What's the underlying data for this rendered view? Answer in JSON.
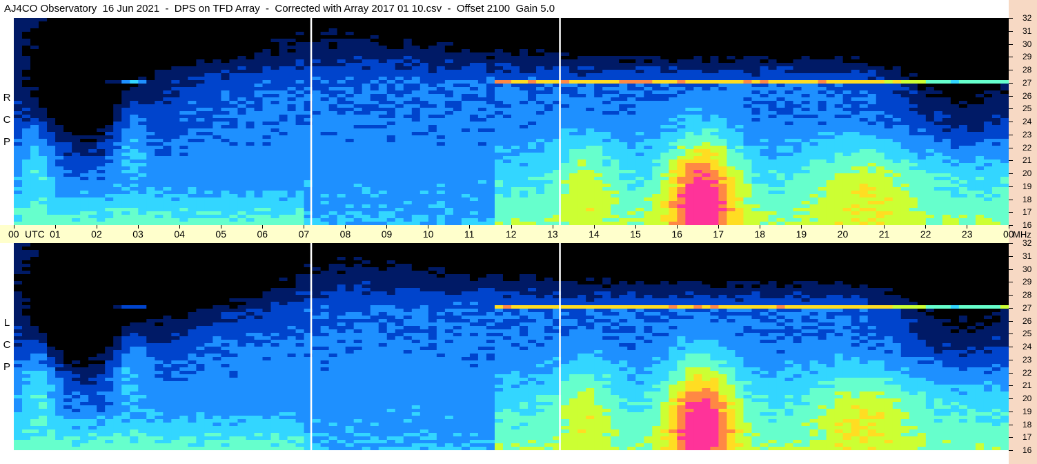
{
  "title": "AJ4CO Observatory  16 Jun 2021  -  DPS on TFD Array  -  Corrected with Array 2017 01 10.csv  -  Offset 2100  Gain 5.0",
  "chart_data": [
    {
      "type": "heatmap",
      "polarization_label": [
        "R",
        "C",
        "P"
      ],
      "x_label": "UTC",
      "y_unit": "MHz",
      "xlim": [
        0,
        24
      ],
      "ylim": [
        16,
        32
      ],
      "x_ticks": [
        "00",
        "01",
        "02",
        "03",
        "04",
        "05",
        "06",
        "07",
        "08",
        "09",
        "10",
        "11",
        "12",
        "13",
        "14",
        "15",
        "16",
        "17",
        "18",
        "19",
        "20",
        "21",
        "22",
        "23",
        "00"
      ],
      "y_ticks": [
        "16",
        "17",
        "18",
        "19",
        "20",
        "21",
        "22",
        "23",
        "24",
        "25",
        "26",
        "27",
        "28",
        "29",
        "30",
        "31",
        "32"
      ],
      "colormap": [
        "#000000",
        "#001a66",
        "#0044cc",
        "#1e90ff",
        "#33d6ff",
        "#66ffcc",
        "#ccff33",
        "#ffdd22",
        "#ff8844",
        "#ff3399"
      ],
      "events": [
        {
          "type": "calibration_line",
          "time": 7.17
        },
        {
          "type": "calibration_line",
          "time": 13.17
        }
      ]
    },
    {
      "type": "heatmap",
      "polarization_label": [
        "L",
        "C",
        "P"
      ],
      "x_label": "UTC",
      "y_unit": "MHz",
      "xlim": [
        0,
        24
      ],
      "ylim": [
        16,
        32
      ],
      "x_ticks": [
        "00",
        "01",
        "02",
        "03",
        "04",
        "05",
        "06",
        "07",
        "08",
        "09",
        "10",
        "11",
        "12",
        "13",
        "14",
        "15",
        "16",
        "17",
        "18",
        "19",
        "20",
        "21",
        "22",
        "23",
        "00"
      ],
      "y_ticks": [
        "16",
        "17",
        "18",
        "19",
        "20",
        "21",
        "22",
        "23",
        "24",
        "25",
        "26",
        "27",
        "28",
        "29",
        "30",
        "31",
        "32"
      ],
      "colormap": [
        "#000000",
        "#001a66",
        "#0044cc",
        "#1e90ff",
        "#33d6ff",
        "#66ffcc",
        "#ccff33",
        "#ffdd22",
        "#ff8844",
        "#ff3399"
      ],
      "events": [
        {
          "type": "calibration_line",
          "time": 7.17
        },
        {
          "type": "calibration_line",
          "time": 13.17
        }
      ]
    }
  ],
  "colors": {
    "axis_background": "#ffffcc",
    "freq_strip": "#f7d9c4"
  }
}
